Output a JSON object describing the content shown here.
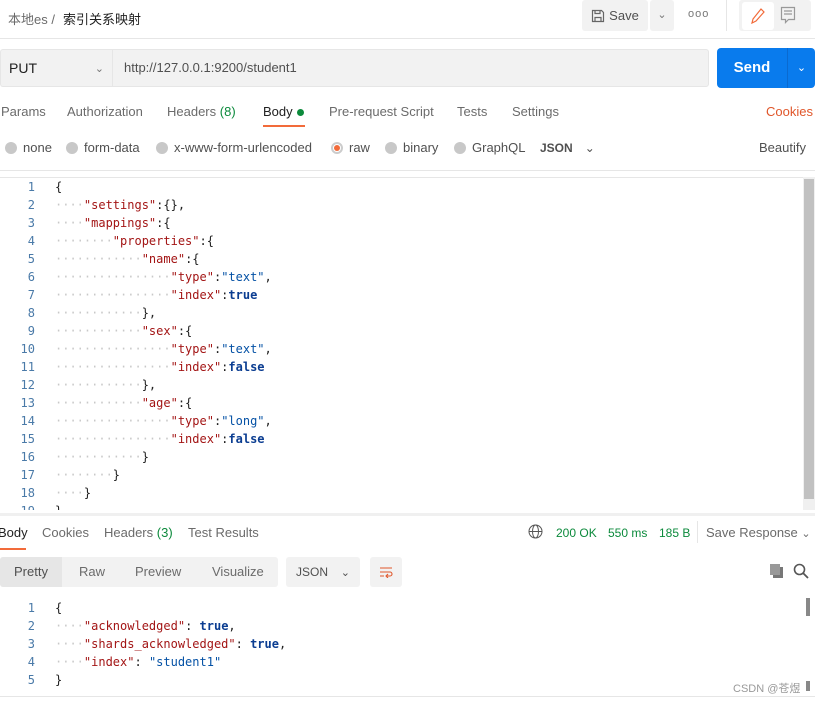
{
  "breadcrumb": {
    "collection": "本地es",
    "separator": "/",
    "request": "索引关系映射"
  },
  "toolbar": {
    "save_label": "Save",
    "more": "ooo"
  },
  "request": {
    "method": "PUT",
    "url": "http://127.0.0.1:9200/student1",
    "send_label": "Send"
  },
  "tabs": {
    "params": "Params",
    "authorization": "Authorization",
    "headers": "Headers",
    "headers_count": "(8)",
    "body": "Body",
    "prerequest": "Pre-request Script",
    "tests": "Tests",
    "settings": "Settings",
    "cookies": "Cookies"
  },
  "body_types": {
    "none": "none",
    "form_data": "form-data",
    "urlencoded": "x-www-form-urlencoded",
    "raw": "raw",
    "binary": "binary",
    "graphql": "GraphQL",
    "format": "JSON",
    "beautify": "Beautify",
    "selected": "raw"
  },
  "editor": {
    "lines": [
      "{",
      "    \"settings\":{},",
      "    \"mappings\":{",
      "        \"properties\":{",
      "            \"name\":{",
      "                \"type\":\"text\",",
      "                \"index\":true",
      "            },",
      "            \"sex\":{",
      "                \"type\":\"text\",",
      "                \"index\":false",
      "            },",
      "            \"age\":{",
      "                \"type\":\"long\",",
      "                \"index\":false",
      "            }",
      "        }",
      "    }",
      "}"
    ]
  },
  "response": {
    "tabs": {
      "body": "Body",
      "cookies": "Cookies",
      "headers": "Headers",
      "headers_count": "(3)",
      "test_results": "Test Results"
    },
    "status": "200 OK",
    "time": "550 ms",
    "size": "185 B",
    "save_response": "Save Response",
    "views": {
      "pretty": "Pretty",
      "raw": "Raw",
      "preview": "Preview",
      "visualize": "Visualize",
      "format": "JSON"
    },
    "lines": [
      "{",
      "    \"acknowledged\": true,",
      "    \"shards_acknowledged\": true,",
      "    \"index\": \"student1\"",
      "}"
    ]
  },
  "watermark": "CSDN @苍煜",
  "colors": {
    "accent": "#f26b3a",
    "send": "#097bed",
    "success": "#0c8a3c"
  }
}
